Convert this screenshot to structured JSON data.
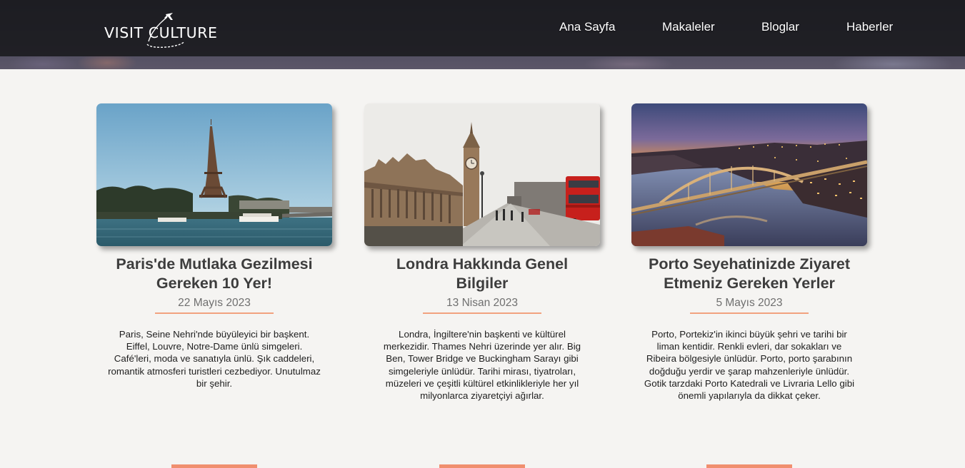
{
  "brand": {
    "logo_text": "VISIT CULTURE"
  },
  "nav": {
    "items": [
      {
        "label": "Ana Sayfa"
      },
      {
        "label": "Makaleler"
      },
      {
        "label": "Bloglar"
      },
      {
        "label": "Haberler"
      }
    ]
  },
  "colors": {
    "accent": "#f08f6f",
    "underline": "#f2a27f",
    "background": "#f5f4f2",
    "navbar": "#19191c"
  },
  "cards": [
    {
      "image": "eiffel-tower-photo",
      "title": "Paris'de Mutlaka Gezilmesi Gereken 10 Yer!",
      "date": "22 Mayıs 2023",
      "description": "Paris, Seine Nehri'nde büyüleyici bir başkent. Eiffel, Louvre, Notre-Dame ünlü simgeleri. Café'leri, moda ve sanatıyla ünlü. Şık caddeleri, romantik atmosferi turistleri cezbediyor. Unutulmaz bir şehir."
    },
    {
      "image": "big-ben-photo",
      "title": "Londra Hakkında Genel Bilgiler",
      "date": "13 Nisan 2023",
      "description": "Londra, İngiltere'nin başkenti ve kültürel merkezidir. Thames Nehri üzerinde yer alır. Big Ben, Tower Bridge ve Buckingham Sarayı gibi simgeleriyle ünlüdür. Tarihi mirası, tiyatroları, müzeleri ve çeşitli kültürel etkinlikleriyle her yıl milyonlarca ziyaretçiyi ağırlar."
    },
    {
      "image": "porto-bridge-photo",
      "title": "Porto Seyehatinizde Ziyaret Etmeniz Gereken Yerler",
      "date": "5 Mayıs 2023",
      "description": "Porto, Portekiz'in ikinci büyük şehri ve tarihi bir liman kentidir. Renkli evleri, dar sokakları ve Ribeira bölgesiyle ünlüdür. Porto, porto şarabının doğduğu yerdir ve şarap mahzenleriyle ünlüdür. Gotik tarzdaki Porto Katedrali ve Livraria Lello gibi önemli yapılarıyla da dikkat çeker."
    }
  ]
}
